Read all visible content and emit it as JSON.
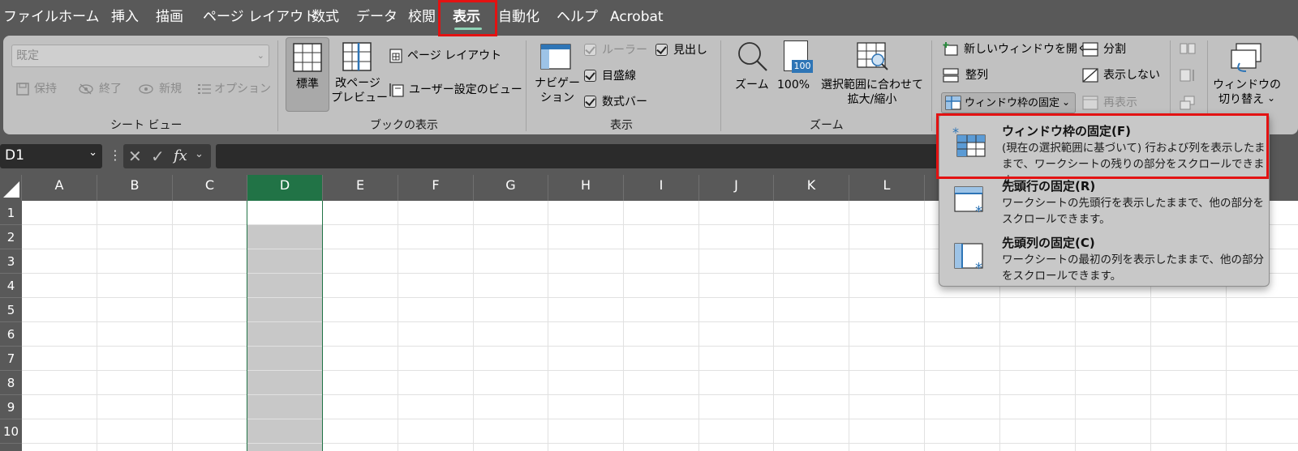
{
  "menu": {
    "tabs": [
      "ファイル",
      "ホーム",
      "挿入",
      "描画",
      "ページ レイアウト",
      "数式",
      "データ",
      "校閲",
      "表示",
      "自動化",
      "ヘルプ",
      "Acrobat"
    ],
    "active_tab": "表示"
  },
  "ribbon": {
    "sheet_view": {
      "dropdown_value": "既定",
      "keep": "保持",
      "exit": "終了",
      "new": "新規",
      "options": "オプション",
      "group_label": "シート ビュー"
    },
    "book_view": {
      "normal": "標準",
      "page_break_line1": "改ページ",
      "page_break_line2": "プレビュー",
      "page_layout": "ページ レイアウト",
      "custom_views": "ユーザー設定のビュー",
      "group_label": "ブックの表示"
    },
    "show": {
      "navigation_line1": "ナビゲー",
      "navigation_line2": "ション",
      "ruler": "ルーラー",
      "gridlines": "目盛線",
      "formula_bar": "数式バー",
      "headings": "見出し",
      "group_label": "表示"
    },
    "zoom": {
      "zoom": "ズーム",
      "hundred": "100%",
      "hundred_icon_text": "100",
      "fit_selection_line1": "選択範囲に合わせて",
      "fit_selection_line2": "拡大/縮小",
      "group_label": "ズーム"
    },
    "window": {
      "new_window": "新しいウィンドウを開く",
      "arrange": "整列",
      "freeze_panes": "ウィンドウ枠の固定",
      "split": "分割",
      "hide": "表示しない",
      "unhide": "再表示",
      "switch_line1": "ウィンドウの",
      "switch_line2": "切り替え"
    }
  },
  "formula_bar": {
    "name_box": "D1",
    "fx": "fx",
    "content": ""
  },
  "grid": {
    "columns": [
      "A",
      "B",
      "C",
      "D",
      "E",
      "F",
      "G",
      "H",
      "I",
      "J",
      "K",
      "L"
    ],
    "rows": [
      "1",
      "2",
      "3",
      "4",
      "5",
      "6",
      "7",
      "8",
      "9",
      "10"
    ],
    "selected_column": "D",
    "active_cell": "D1"
  },
  "freeze_menu": {
    "items": [
      {
        "title": "ウィンドウ枠の固定(F)",
        "desc": "(現在の選択範囲に基づいて) 行および列を表示したままで、ワークシートの残りの部分をスクロールできます。"
      },
      {
        "title": "先頭行の固定(R)",
        "desc": "ワークシートの先頭行を表示したままで、他の部分をスクロールできます。"
      },
      {
        "title": "先頭列の固定(C)",
        "desc": "ワークシートの最初の列を表示したままで、他の部分をスクロールできます。"
      }
    ]
  },
  "colors": {
    "menu_bg": "#595959",
    "ribbon_bg": "#c1c1c1",
    "selected_header": "#217346",
    "highlight": "#e31212",
    "icon_blue": "#2e75b6"
  }
}
